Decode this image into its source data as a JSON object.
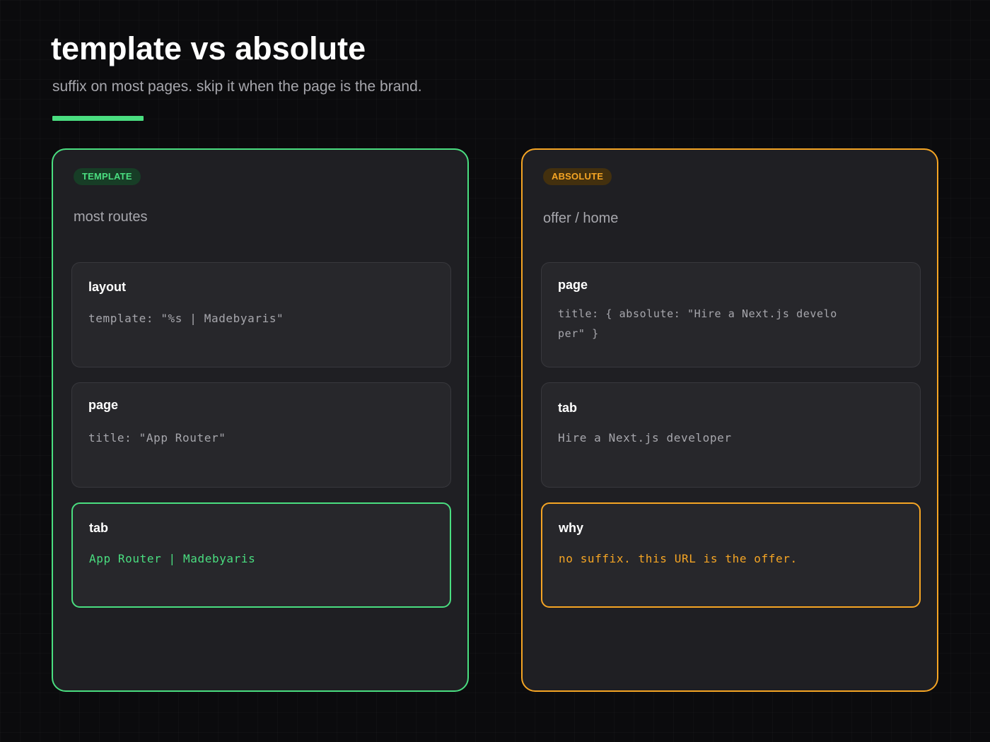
{
  "header": {
    "title": "template vs absolute",
    "subtitle": "suffix on most pages. skip it when the page is the brand."
  },
  "colors": {
    "background": "#0b0b0d",
    "panel": "#1f1f23",
    "card": "#27272b",
    "template_accent": "#4ade80",
    "absolute_accent": "#f5a524",
    "muted_text": "#a7a7ad"
  },
  "template_panel": {
    "badge": "TEMPLATE",
    "caption": "most routes",
    "cards": [
      {
        "title": "layout",
        "code": "template: \"%s | Madebyaris\""
      },
      {
        "title": "page",
        "code": "title: \"App Router\""
      },
      {
        "title": "tab",
        "code": "App Router | Madebyaris"
      }
    ]
  },
  "absolute_panel": {
    "badge": "ABSOLUTE",
    "caption": "offer / home",
    "cards": [
      {
        "title": "page",
        "code": "title: { absolute: \"Hire a Next.js developer\" }"
      },
      {
        "title": "tab",
        "code": "Hire a Next.js developer"
      },
      {
        "title": "why",
        "code": "no suffix. this URL is the offer."
      }
    ]
  }
}
